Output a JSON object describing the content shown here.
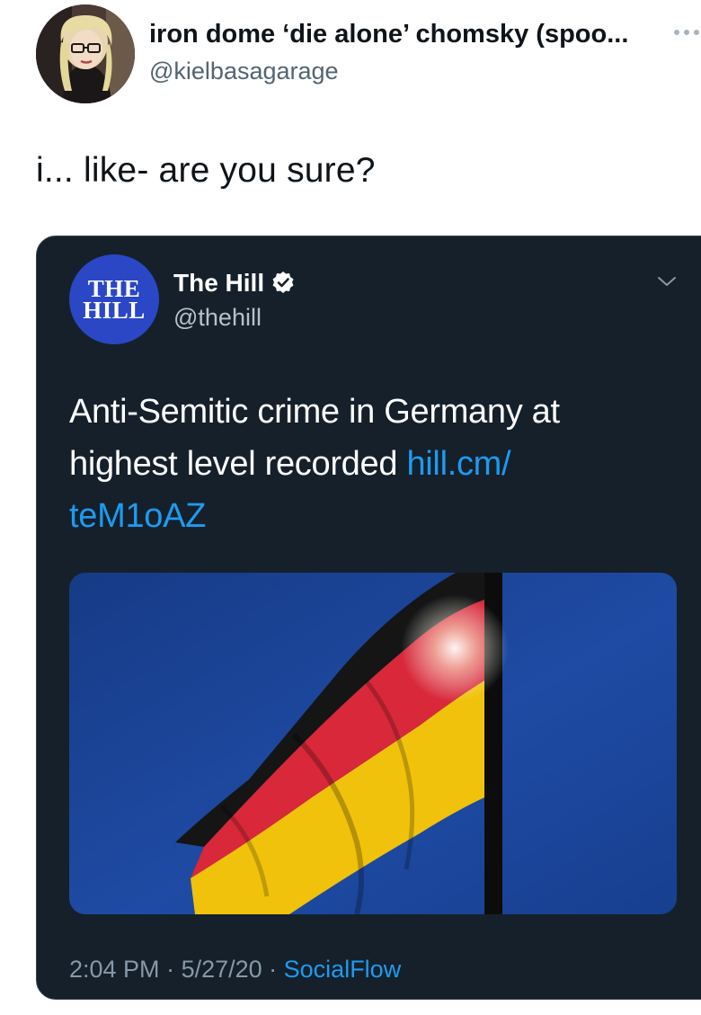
{
  "tweet": {
    "author_name": "iron dome ‘die alone’ chomsky (spoo...",
    "author_handle": "@kielbasagarage",
    "text": "i... like- are you sure?"
  },
  "quoted_tweet": {
    "logo_line1": "THE",
    "logo_line2": "HILL",
    "name": "The Hill",
    "handle": "@thehill",
    "text": "Anti-Semitic crime in Germany at highest level recorded ",
    "link_line1": "hill.cm/",
    "link_line2": "teM1oAZ",
    "time": "2:04 PM",
    "separator": " · ",
    "date": "5/27/20",
    "source": "SocialFlow"
  },
  "icons": {
    "more": "more-icon",
    "verified": "verified-badge-icon",
    "chevron": "chevron-down-icon"
  },
  "colors": {
    "link": "#1d9bf0",
    "card_background": "#15202b",
    "logo_blue": "#2b47c6"
  }
}
